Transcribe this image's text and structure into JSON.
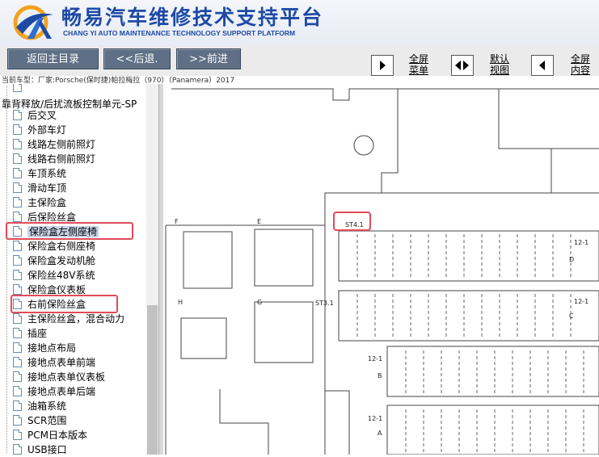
{
  "header": {
    "title_cn": "畅易汽车维修技术支持平台",
    "title_en": "CHANG YI AUTO MAINTENANCE TECHNOLOGY SUPPORT PLATFORM"
  },
  "toolbar": {
    "back_main": "返回主目录",
    "prev": "<<后退.",
    "next": ">>前进",
    "fullscreen_menu_1": "全屏",
    "fullscreen_menu_2": "菜单",
    "default_view_1": "默认",
    "default_view_2": "视图",
    "fullscreen_content_1": "全屏",
    "fullscreen_content_2": "内容"
  },
  "car_info": "当前车型：厂家:Porsche(保时捷)帕拉梅拉（970）（Panamera）2017",
  "tree": {
    "title": "靠背释放/后扰流板控制单元-SP",
    "items": [
      "后交叉",
      "外部车灯",
      "线路左侧前照灯",
      "线路右侧前照灯",
      "车顶系统",
      "滑动车顶",
      "主保险盒",
      "后保险丝盒",
      "保险盒左侧座椅",
      "保险盒右侧座椅",
      "保险盒发动机舱",
      "保险丝48V系统",
      "保险盒仪表板",
      "右前保险丝盒",
      "主保险丝盒，混合动力",
      "插座",
      "接地点布局",
      "接地点表单前端",
      "接地点表单仪表板",
      "接地点表单后端",
      "油箱系统",
      "SCR范围",
      "PCM日本版本",
      "USB接口"
    ]
  },
  "diagram": {
    "labels": {
      "F": "F",
      "E": "E",
      "st41": "ST4.1",
      "st31": "ST3.1",
      "H": "H",
      "G": "G",
      "D": "D",
      "C": "C",
      "B": "B",
      "A": "A",
      "r12a": "12-1",
      "r12b": "12-1",
      "r12c": "12-1",
      "r12d": "12-1"
    }
  },
  "colors": {
    "brand": "#1e4aa6",
    "button": "#5e6f86",
    "highlight": "#e24b5a",
    "selected": "#c7d3e6"
  }
}
